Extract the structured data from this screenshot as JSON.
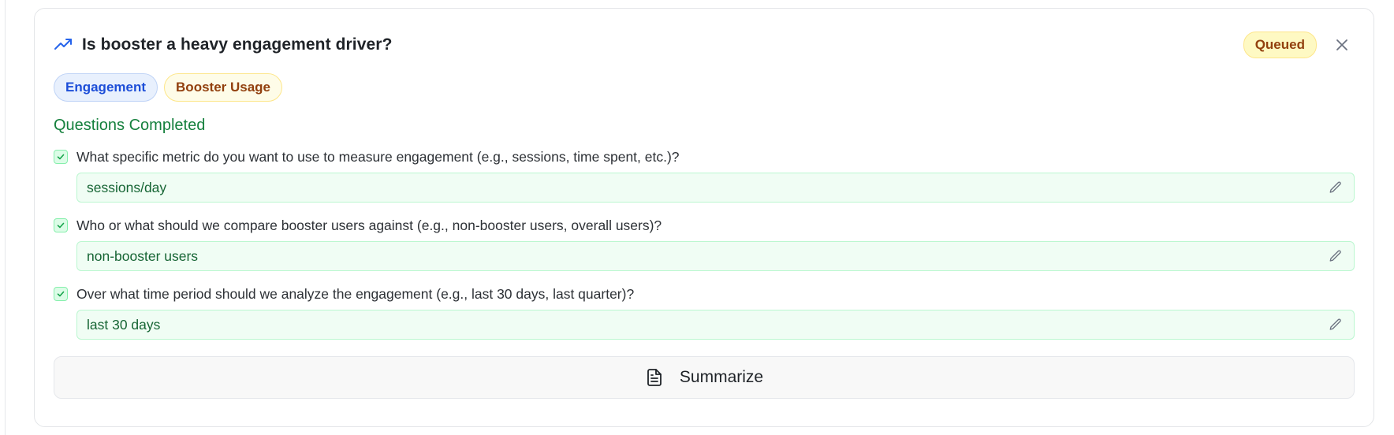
{
  "card": {
    "title": "Is booster a heavy engagement driver?",
    "icon": "trending-up-icon",
    "status": "Queued",
    "close_icon": "close-icon",
    "accent_color": "#2563eb"
  },
  "tags": [
    {
      "label": "Engagement",
      "color": "#1d4ed8"
    },
    {
      "label": "Booster Usage",
      "color": "#92400e"
    }
  ],
  "section": {
    "title": "Questions Completed",
    "color": "#15803d"
  },
  "questions": [
    {
      "question": "What specific metric do you want to use to measure engagement (e.g., sessions, time spent, etc.)?",
      "answer": "sessions/day"
    },
    {
      "question": "Who or what should we compare booster users against (e.g., non-booster users, overall users)?",
      "answer": "non-booster users"
    },
    {
      "question": "Over what time period should we analyze the engagement (e.g., last 30 days, last quarter)?",
      "answer": "last 30 days"
    }
  ],
  "actions": {
    "summarize_label": "Summarize",
    "summarize_icon": "document-icon"
  }
}
